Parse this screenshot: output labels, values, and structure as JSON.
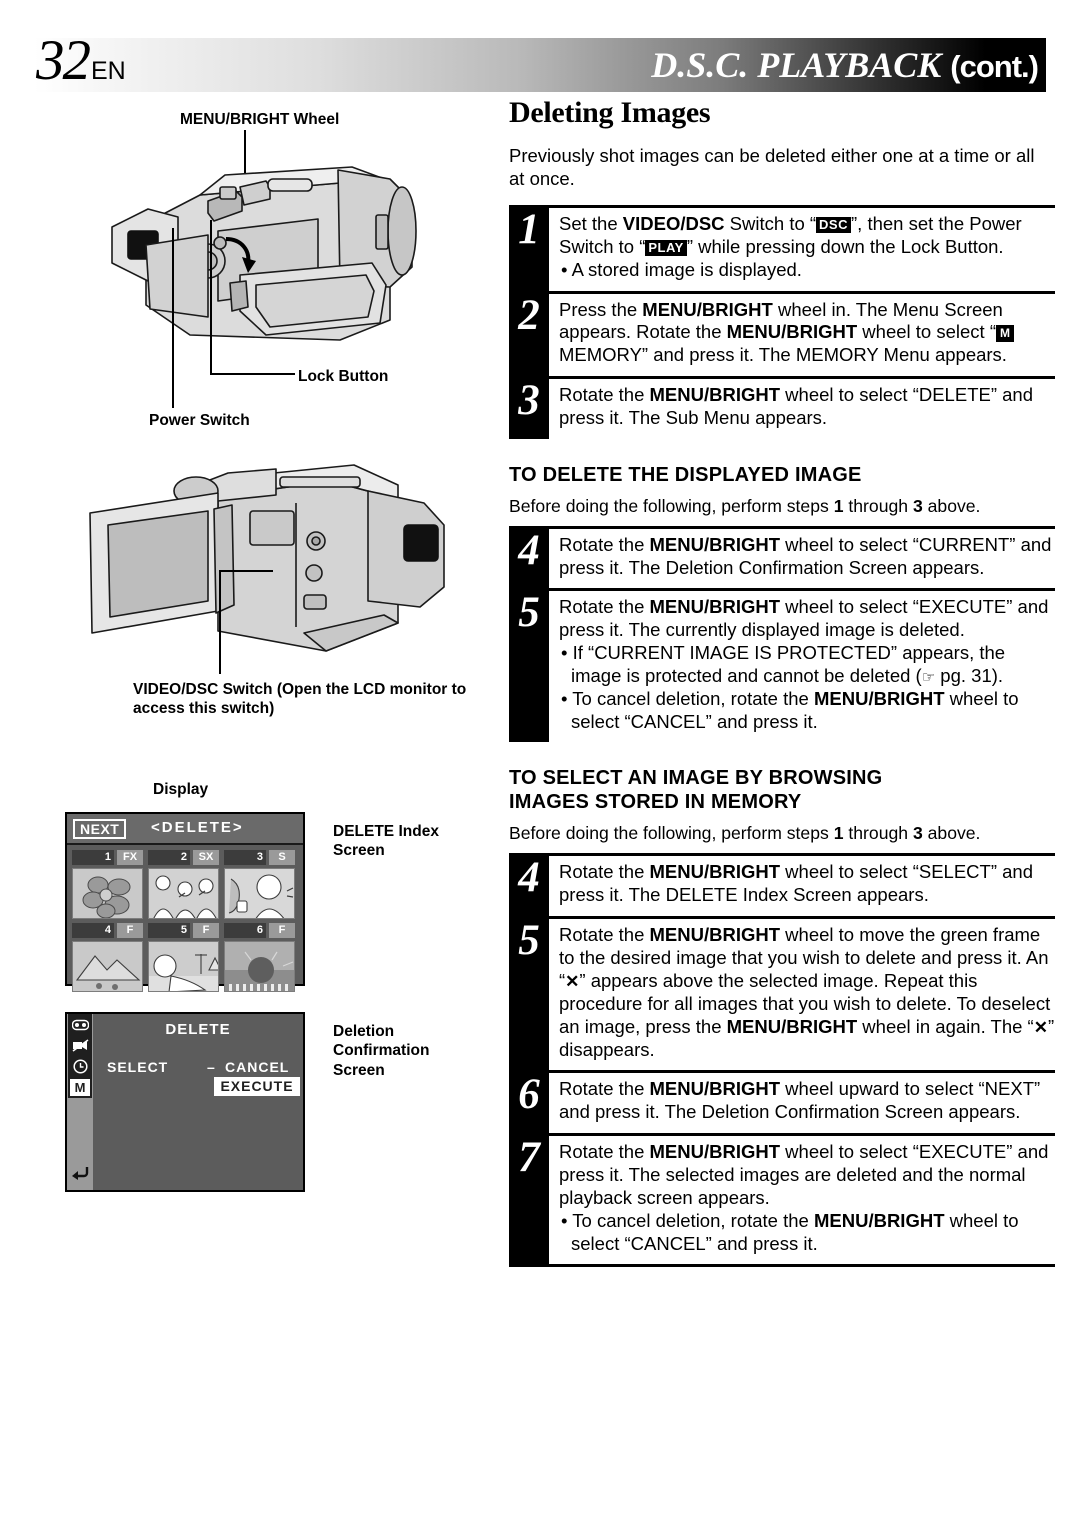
{
  "header": {
    "page_number": "32",
    "language_code": "EN",
    "title": "D.S.C.  PLAYBACK",
    "title_cont": "(cont.)"
  },
  "diagram": {
    "labels": {
      "menu_bright_wheel": "MENU/BRIGHT Wheel",
      "lock_button": "Lock Button",
      "power_switch": "Power Switch",
      "video_dsc_switch": "VIDEO/DSC Switch (Open the LCD monitor to access this switch)",
      "display": "Display",
      "delete_index_screen": "DELETE Index Screen",
      "deletion_confirmation_screen": "Deletion Confirmation Screen"
    }
  },
  "index_screen": {
    "next_label": "NEXT",
    "title": "<DELETE>",
    "cells": [
      {
        "number": "1",
        "tag": "FX",
        "image": "flower"
      },
      {
        "number": "2",
        "tag": "SX",
        "image": "people-singing"
      },
      {
        "number": "3",
        "tag": "S",
        "image": "woman-drinking"
      },
      {
        "number": "4",
        "tag": "F",
        "image": "mountains"
      },
      {
        "number": "5",
        "tag": "F",
        "image": "beach-person"
      },
      {
        "number": "6",
        "tag": "F",
        "image": "sunset-pier"
      }
    ]
  },
  "confirmation_screen": {
    "title": "DELETE",
    "select_label": "SELECT",
    "dash": "–",
    "cancel_label": "CANCEL",
    "execute_label": "EXECUTE",
    "sidebar_icons": [
      "camera-tape-icon",
      "camera-slash-icon",
      "clock-icon",
      "memory-m-icon",
      "return-arrow-icon"
    ],
    "selected_sidebar_icon": "M"
  },
  "main": {
    "section_title": "Deleting Images",
    "intro": "Previously shot images can be deleted either one at a time or all at once.",
    "steps_main": [
      {
        "num": "1",
        "lines": [
          {
            "type": "text",
            "html": "Set the <b>VIDEO/DSC</b> Switch to “<span class=\"chip\">DSC</span>”, then set the Power Switch to “<span class=\"chip\">PLAY</span>” while pressing down the Lock Button."
          },
          {
            "type": "bullet",
            "html": "• A stored image is displayed."
          }
        ]
      },
      {
        "num": "2",
        "lines": [
          {
            "type": "text",
            "html": "Press the <b>MENU/BRIGHT</b> wheel in. The Menu Screen appears. Rotate the <b>MENU/BRIGHT</b> wheel to select “<span class=\"mchip\">M</span> MEMORY” and press it. The MEMORY Menu appears."
          }
        ]
      },
      {
        "num": "3",
        "lines": [
          {
            "type": "text",
            "html": "Rotate the <b>MENU/BRIGHT</b> wheel to select “DELETE” and press it. The Sub Menu appears."
          }
        ]
      }
    ],
    "section_a": {
      "heading": "TO DELETE THE DISPLAYED IMAGE",
      "before_text": "Before doing the following, perform steps <b>1</b> through <b>3</b> above.",
      "steps": [
        {
          "num": "4",
          "lines": [
            {
              "type": "text",
              "html": "Rotate the <b>MENU/BRIGHT</b> wheel to select “CURRENT” and press it. The Deletion Confirmation Screen appears."
            }
          ]
        },
        {
          "num": "5",
          "lines": [
            {
              "type": "text",
              "html": "Rotate the <b>MENU/BRIGHT</b> wheel to select “EXECUTE” and press it. The currently displayed image is deleted."
            },
            {
              "type": "bullet",
              "html": "• If “CURRENT IMAGE IS PROTECTED” appears, the image is protected and cannot be deleted (<span class=\"handicon\">☞</span> pg. 31)."
            },
            {
              "type": "bullet",
              "html": "• To cancel deletion, rotate the <b>MENU/BRIGHT</b> wheel to select “CANCEL” and press it."
            }
          ]
        }
      ]
    },
    "section_b": {
      "heading_line1": "TO SELECT AN IMAGE BY BROWSING",
      "heading_line2": "IMAGES STORED IN MEMORY",
      "before_text": "Before doing the following, perform steps <b>1</b> through <b>3</b> above.",
      "steps": [
        {
          "num": "4",
          "lines": [
            {
              "type": "text",
              "html": "Rotate the <b>MENU/BRIGHT</b> wheel to select “SELECT” and press it. The DELETE Index Screen appears."
            }
          ]
        },
        {
          "num": "5",
          "lines": [
            {
              "type": "text",
              "html": "Rotate the <b>MENU/BRIGHT</b> wheel to move the green frame to the desired image that you wish to delete and press it. An “<span class=\"xmark\">✕</span>” appears above the selected image."
            },
            {
              "type": "text",
              "html": "Repeat this procedure for all images that you wish to delete."
            },
            {
              "type": "text",
              "html": "To deselect an image, press the <b>MENU/BRIGHT</b> wheel in again. The “<span class=\"xmark\">✕</span>” disappears."
            }
          ]
        },
        {
          "num": "6",
          "lines": [
            {
              "type": "text",
              "html": "Rotate the <b>MENU/BRIGHT</b> wheel upward to select “NEXT” and press it. The Deletion Confirmation Screen appears."
            }
          ]
        },
        {
          "num": "7",
          "lines": [
            {
              "type": "text",
              "html": "Rotate the <b>MENU/BRIGHT</b> wheel to select “EXECUTE” and press it. The selected images are deleted and the normal playback screen appears."
            },
            {
              "type": "bullet",
              "html": "• To cancel deletion, rotate the <b>MENU/BRIGHT</b> wheel to select “CANCEL” and press it."
            }
          ]
        }
      ]
    }
  },
  "colors": {
    "ink": "#000000",
    "paper": "#ffffff",
    "lcd_background": "#5c5c5c",
    "lcd_chrome": "#9a9a9a"
  }
}
